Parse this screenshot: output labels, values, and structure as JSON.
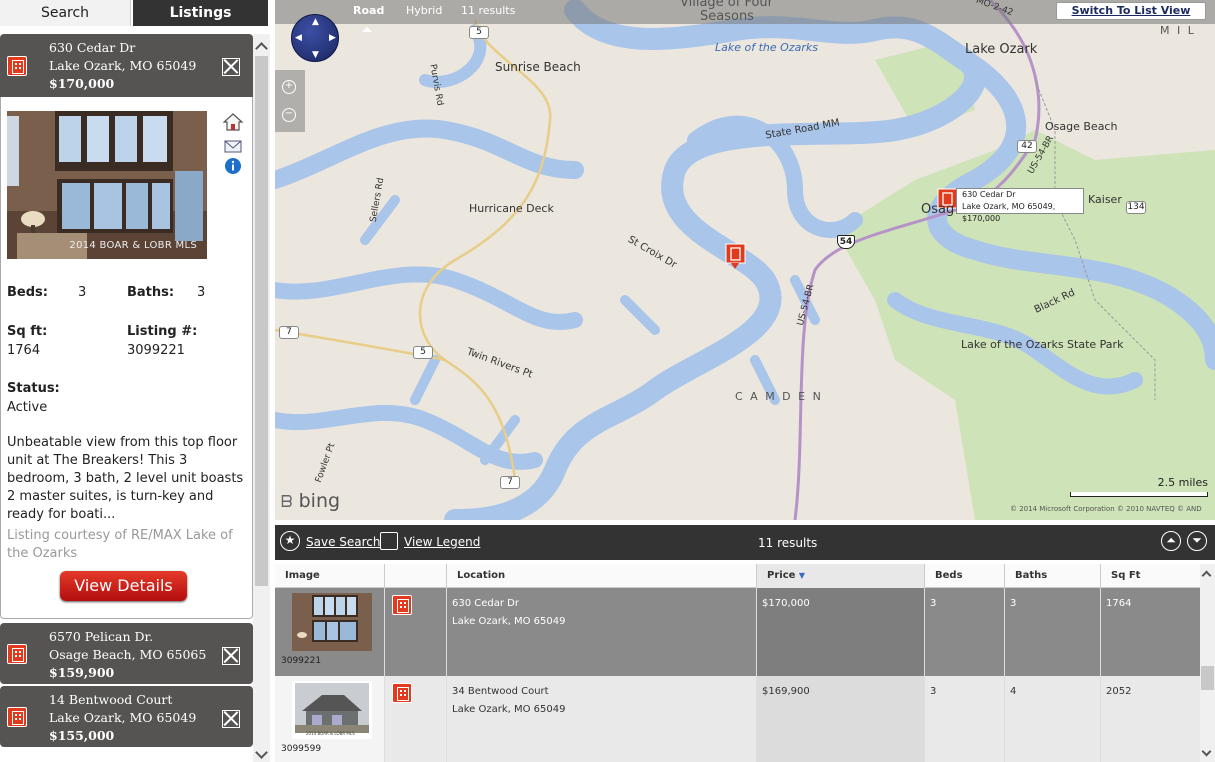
{
  "tabs": {
    "search": "Search",
    "listings": "Listings"
  },
  "listings": [
    {
      "address": "630 Cedar Dr",
      "city": "Lake Ozark, MO 65049",
      "price": "$170,000"
    },
    {
      "address": "6570 Pelican Dr.",
      "city": "Osage Beach, MO 65065",
      "price": "$159,900"
    },
    {
      "address": "14 Bentwood Court",
      "city": "Lake Ozark, MO 65049",
      "price": "$155,000"
    }
  ],
  "detail": {
    "photo_watermark": "2014 BOAR & LOBR MLS",
    "beds_label": "Beds:",
    "beds": "3",
    "baths_label": "Baths:",
    "baths": "3",
    "sqft_label": "Sq ft:",
    "sqft": "1764",
    "listing_label": "Listing #:",
    "listing": "3099221",
    "status_label": "Status:",
    "status": "Active",
    "description": "Unbeatable view from this top floor unit at The Breakers! This 3 bedroom, 3 bath, 2 level unit boasts 2 master suites, is turn-key and ready for boati...",
    "courtesy": "Listing courtesy of RE/MAX Lake of the Ozarks",
    "view_details": "View Details"
  },
  "map": {
    "mode_road": "Road",
    "mode_hybrid": "Hybrid",
    "results": "11 results",
    "switch_view": "Switch To List View",
    "scale": "2.5 miles",
    "brand": "bing",
    "copyright": "© 2014 Microsoft Corporation   © 2010 NAVTEQ   © AND",
    "popup_line1": "630 Cedar Dr",
    "popup_line2": "Lake Ozark, MO 65049, $170,000",
    "labels": {
      "village": "Village of Four",
      "seasons": "Seasons",
      "lake_ozarks": "Lake of the Ozarks",
      "lake_ozark": "Lake Ozark",
      "sunrise_beach": "Sunrise Beach",
      "osage_beach": "Osage Beach",
      "purvis": "Purvis Rd",
      "state_road_mm": "State Road MM",
      "sellers": "Sellers Rd",
      "hurricane": "Hurricane Deck",
      "st_croix": "St Croix Dr",
      "kaiser": "Kaiser",
      "osage": "Osag",
      "us54br": "US-54-BR",
      "us54br2": "US-54-BR",
      "black_rd": "Black Rd",
      "state_park": "Lake of the Ozarks State Park",
      "twin_rivers": "Twin Rivers Pt",
      "camden": "C A M D E N",
      "fowler": "Fowler Pt",
      "mil": "M I L",
      "mo242": "MO-2-42"
    },
    "shields": {
      "r5a": "5",
      "r5b": "5",
      "r7a": "7",
      "r7b": "7",
      "r42": "42",
      "r134": "134",
      "us54": "54"
    }
  },
  "results_bar": {
    "save_search": "Save Search",
    "view_legend": "View Legend",
    "count": "11 results"
  },
  "grid": {
    "headers": {
      "image": "Image",
      "location": "Location",
      "price": "Price",
      "beds": "Beds",
      "baths": "Baths",
      "sqft": "Sq Ft"
    },
    "rows": [
      {
        "mls": "3099221",
        "street": "630 Cedar Dr",
        "city": "Lake Ozark, MO  65049",
        "price": "$170,000",
        "beds": "3",
        "baths": "3",
        "sqft": "1764"
      },
      {
        "mls": "3099599",
        "street": "34 Bentwood Court",
        "city": "Lake Ozark, MO  65049",
        "price": "$169,900",
        "beds": "3",
        "baths": "4",
        "sqft": "2052",
        "watermark": "2014 BOAR & LOBR MLS"
      }
    ]
  },
  "colors": {
    "water": "#a9c5ea",
    "land": "#ebe6de",
    "park": "#cfe3b8",
    "accent": "#e23a1c",
    "dark_bar": "#333333"
  }
}
